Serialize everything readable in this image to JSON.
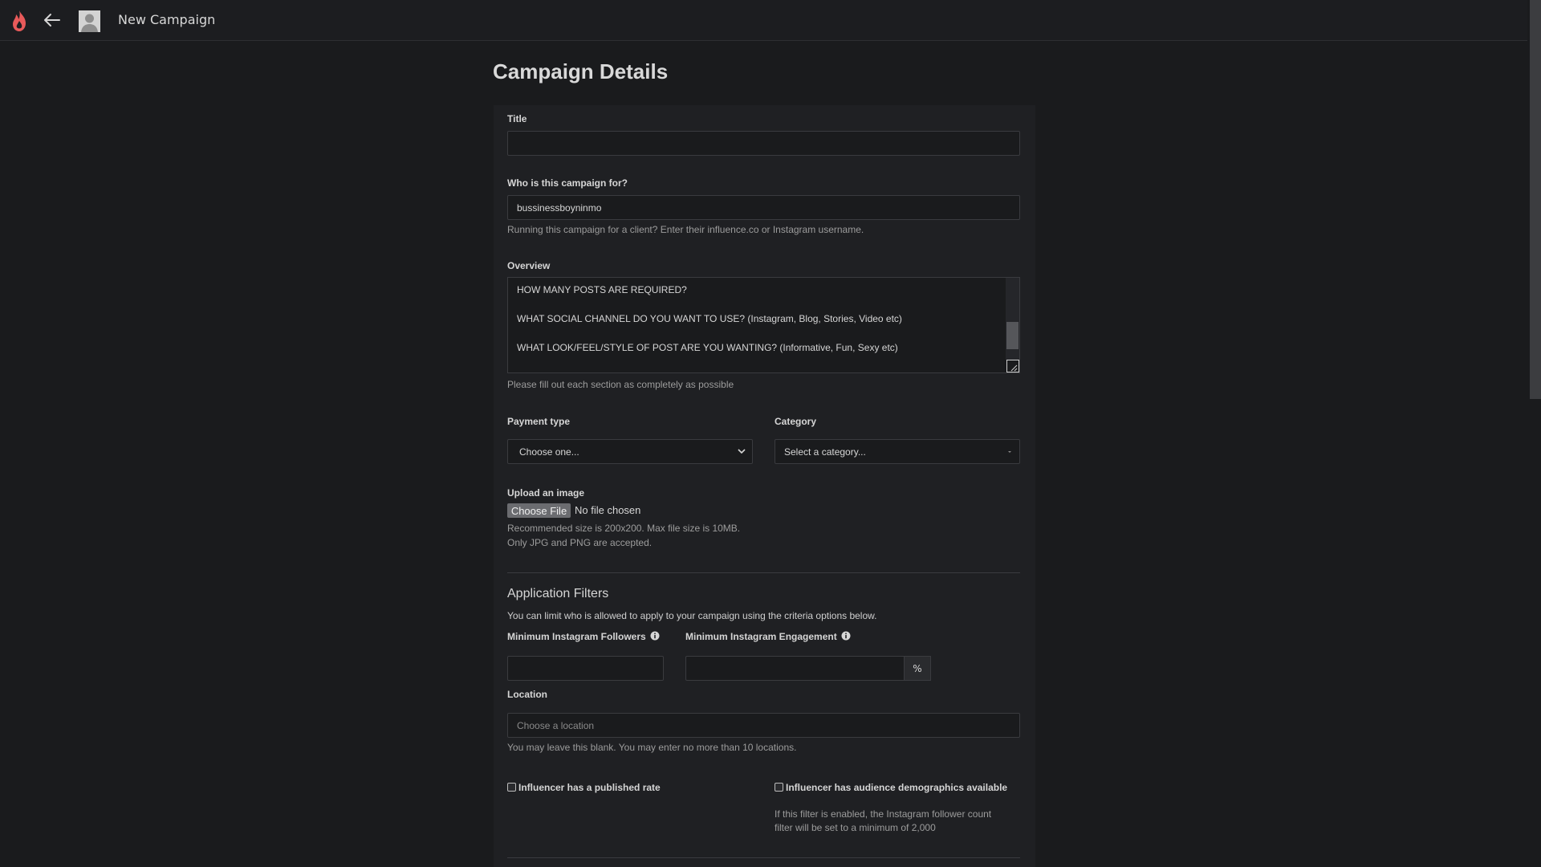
{
  "header": {
    "title": "New Campaign",
    "icons": [
      "flame-logo-icon",
      "back-arrow-icon",
      "avatar"
    ]
  },
  "page": {
    "title": "Campaign Details"
  },
  "form": {
    "title_label": "Title",
    "title_value": "",
    "client_label": "Who is this campaign for?",
    "client_value": "bussinessboyninmo",
    "client_help": "Running this campaign for a client? Enter their influence.co or Instagram username.",
    "overview_label": "Overview",
    "overview_lines": [
      "HOW MANY POSTS ARE REQUIRED?",
      "WHAT SOCIAL CHANNEL DO YOU WANT TO USE? (Instagram, Blog, Stories, Video etc)",
      "WHAT LOOK/FEEL/STYLE OF POST ARE YOU WANTING? (Informative, Fun, Sexy etc)"
    ],
    "overview_help": "Please fill out each section as completely as possible",
    "payment_label": "Payment type",
    "payment_value": "Choose one...",
    "category_label": "Category",
    "category_value": "Select a category...",
    "upload_label": "Upload an image",
    "upload_button": "Choose File",
    "upload_status": "No file chosen",
    "upload_help_1": "Recommended size is 200x200. Max file size is 10MB.",
    "upload_help_2": "Only JPG and PNG are accepted."
  },
  "filters": {
    "title": "Application Filters",
    "description": "You can limit who is allowed to apply to your campaign using the criteria options below.",
    "followers_label": "Minimum Instagram Followers",
    "engagement_label": "Minimum Instagram Engagement",
    "engagement_unit": "%",
    "location_label": "Location",
    "location_placeholder": "Choose a location",
    "location_help": "You may leave this blank. You may enter no more than 10 locations.",
    "published_rate_label": "Influencer has a published rate",
    "demographics_label": "Influencer has audience demographics available",
    "demographics_help_1": "If this filter is enabled, the Instagram follower count",
    "demographics_help_2": "filter will be set to a minimum of 2,000"
  }
}
